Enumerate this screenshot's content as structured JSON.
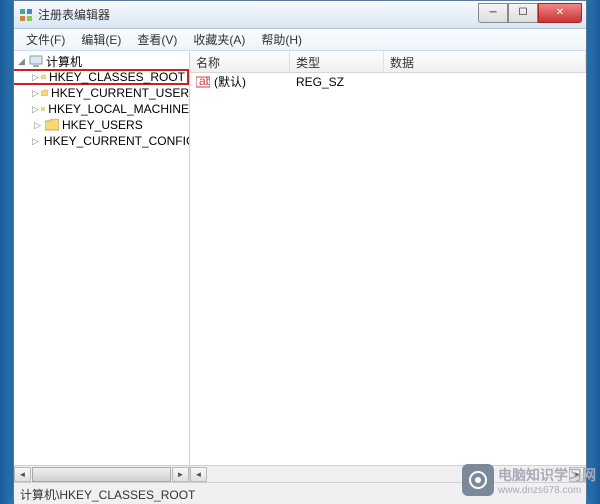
{
  "window": {
    "title": "注册表编辑器"
  },
  "menubar": {
    "file": "文件(F)",
    "edit": "编辑(E)",
    "view": "查看(V)",
    "favorites": "收藏夹(A)",
    "help": "帮助(H)"
  },
  "tree": {
    "root": "计算机",
    "keys": [
      "HKEY_CLASSES_ROOT",
      "HKEY_CURRENT_USER",
      "HKEY_LOCAL_MACHINE",
      "HKEY_USERS",
      "HKEY_CURRENT_CONFIG"
    ]
  },
  "list": {
    "columns": {
      "name": "名称",
      "type": "类型",
      "data": "数据"
    },
    "rows": [
      {
        "name": "(默认)",
        "type": "REG_SZ",
        "data": ""
      }
    ]
  },
  "statusbar": {
    "path": "计算机\\HKEY_CLASSES_ROOT"
  },
  "watermark": {
    "text": "电脑知识学习网",
    "url": "www.dnzs678.com"
  }
}
